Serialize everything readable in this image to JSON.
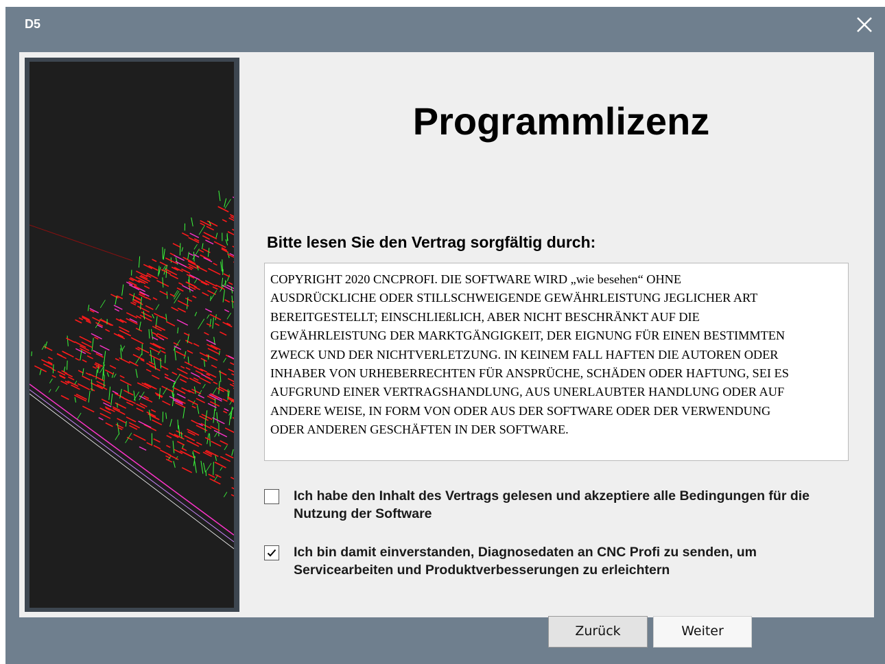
{
  "window": {
    "title": "D5",
    "close_icon": "close-icon"
  },
  "main": {
    "heading": "Programmlizenz",
    "subheading": "Bitte lesen Sie den Vertrag sorgfältig durch:",
    "license_text": "COPYRIGHT 2020 CNCPROFI.  DIE SOFTWARE WIRD „wie besehen“ OHNE\nAUSDRÜCKLICHE ODER STILLSCHWEIGENDE GEWÄHRLEISTUNG JEGLICHER ART\nBEREITGESTELLT; EINSCHLIEßLICH, ABER NICHT BESCHRÄNKT AUF DIE\nGEWÄHRLEISTUNG DER MARKTGÄNGIGKEIT, DER EIGNUNG FÜR EINEN BESTIMMTEN\nZWECK UND DER NICHTVERLETZUNG. IN KEINEM FALL HAFTEN DIE AUTOREN ODER\nINHABER VON URHEBERRECHTEN FÜR ANSPRÜCHE, SCHÄDEN ODER HAFTUNG, SEI ES\nAUFGRUND EINER VERTRAGSHANDLUNG, AUS UNERLAUBTER HANDLUNG ODER AUF\nANDERE WEISE, IN FORM VON ODER AUS DER SOFTWARE ODER DER VERWENDUNG\nODER ANDEREN GESCHÄFTEN IN DER SOFTWARE."
  },
  "checkboxes": [
    {
      "label": "Ich habe den Inhalt des Vertrags gelesen und akzeptiere alle Bedingungen für die Nutzung der Software",
      "checked": false
    },
    {
      "label": "Ich bin damit einverstanden, Diagnosedaten an CNC Profi zu senden, um Servicearbeiten und Produktverbesserungen zu erleichtern",
      "checked": true
    }
  ],
  "buttons": {
    "back_label": "Zurück",
    "next_label": "Weiter"
  },
  "colors": {
    "titlebar": "#6f7f8e",
    "content_bg": "#efefef",
    "side_frame": "#3d4650",
    "render_red": "#ff1a1a",
    "render_green": "#3cff3c",
    "render_magenta": "#ff33cc"
  },
  "side_image": {
    "description_icon": "cnc-toolpath-render-image"
  }
}
